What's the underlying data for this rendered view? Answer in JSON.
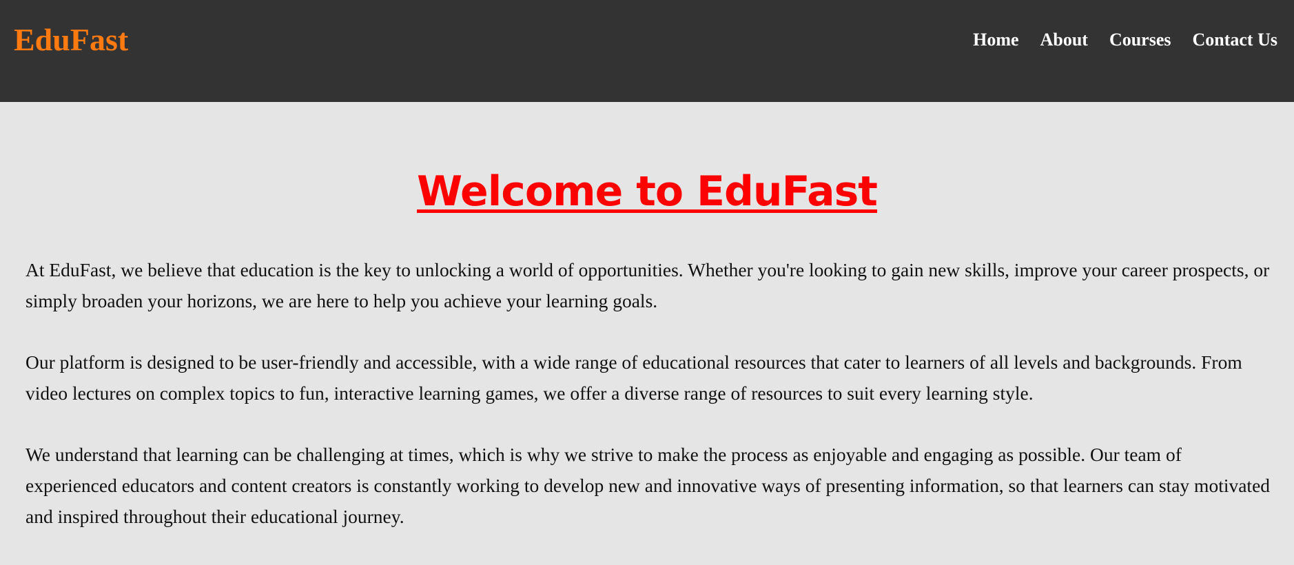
{
  "header": {
    "logo": "EduFast",
    "nav": [
      "Home",
      "About",
      "Courses",
      "Contact Us"
    ]
  },
  "main": {
    "title": "Welcome to EduFast",
    "paragraphs": [
      "At EduFast, we believe that education is the key to unlocking a world of opportunities. Whether you're looking to gain new skills, improve your career prospects, or simply broaden your horizons, we are here to help you achieve your learning goals.",
      "Our platform is designed to be user-friendly and accessible, with a wide range of educational resources that cater to learners of all levels and backgrounds. From video lectures on complex topics to fun, interactive learning games, we offer a diverse range of resources to suit every learning style.",
      "We understand that learning can be challenging at times, which is why we strive to make the process as enjoyable and engaging as possible. Our team of experienced educators and content creators is constantly working to develop new and innovative ways of presenting information, so that learners can stay motivated and inspired throughout their educational journey."
    ]
  },
  "colors": {
    "header_bg": "#333333",
    "logo": "#ff7a11",
    "nav_text": "#ffffff",
    "page_bg": "#e5e5e5",
    "title": "#ff0000",
    "body_text": "#111111"
  }
}
